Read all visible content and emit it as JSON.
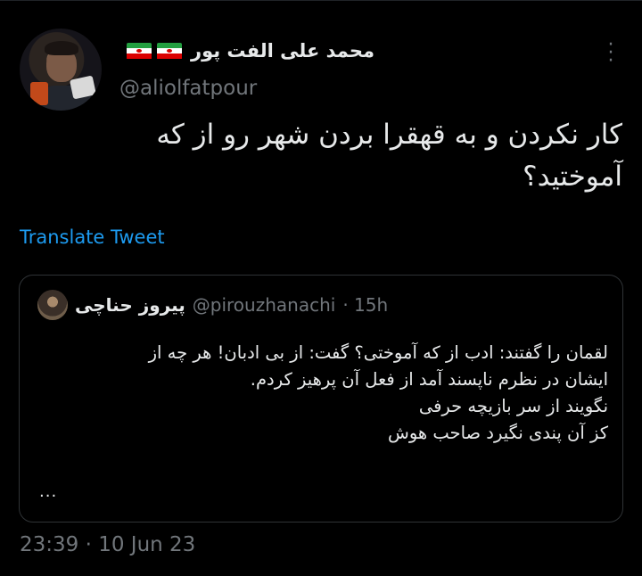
{
  "author": {
    "display_name": "محمد علی الفت پور",
    "handle": "@aliolfatpour",
    "flags": [
      "iran-flag",
      "iran-flag"
    ]
  },
  "tweet": {
    "text_lines": [
      "کار نکردن و به قهقرا بردن شهر رو از که",
      "آموختید؟"
    ],
    "translate_label": "Translate Tweet",
    "timestamp": "23:39 · 10 Jun 23"
  },
  "quote": {
    "display_name": "پیروز حناچی",
    "handle": "@pirouzhanachi",
    "time": "· 15h",
    "lines": [
      "لقمان را گفتند: ادب از که آموختی؟ گفت: از بی ادبان! هر چه از",
      "ایشان در نظرم ناپسند آمد از فعل آن پرهیز کردم.",
      "نگویند از سر بازیچه حرفی",
      "کز آن پندی نگیرد صاحب هوش"
    ],
    "ellipsis": "..."
  },
  "colors": {
    "accent": "#1d9bf0",
    "muted": "#71767b",
    "text": "#e7e9ea",
    "background": "#000000"
  }
}
